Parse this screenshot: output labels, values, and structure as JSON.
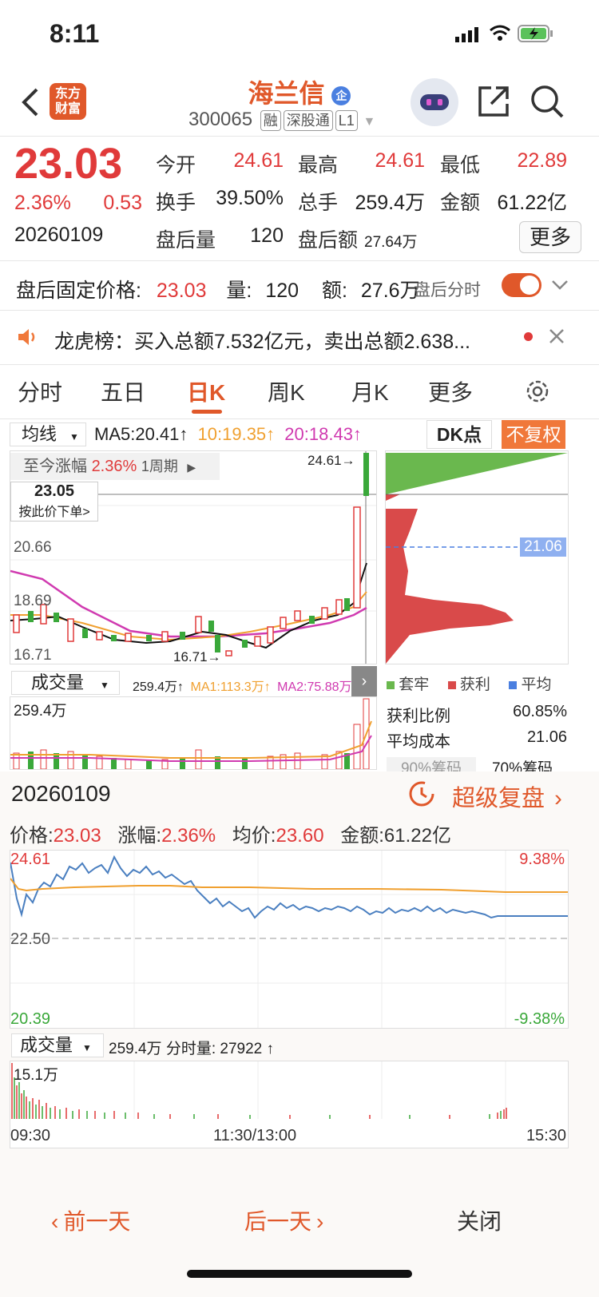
{
  "status": {
    "time": "8:11"
  },
  "header": {
    "title": "海兰信",
    "badge": "企",
    "code": "300065",
    "tags": [
      "融",
      "深股通",
      "L1"
    ],
    "logo_text": [
      "东方",
      "财富"
    ]
  },
  "quote": {
    "price": "23.03",
    "change_pct": "2.36%",
    "change": "0.53",
    "date": "20260109",
    "open_label": "今开",
    "open": "24.61",
    "high_label": "最高",
    "high": "24.61",
    "low_label": "最低",
    "low": "22.89",
    "turnover_label": "换手",
    "turnover": "39.50%",
    "volume_label": "总手",
    "volume": "259.4万",
    "amount_label": "金额",
    "amount": "61.22亿",
    "after_vol_label": "盘后量",
    "after_vol": "120",
    "after_amt_label": "盘后额",
    "after_amt": "27.64万",
    "more": "更多"
  },
  "after_hours": {
    "price_label": "盘后固定价格:",
    "price": "23.03",
    "vol_label": "量:",
    "vol": "120",
    "amt_label": "额:",
    "amt": "27.6万",
    "toggle_label": "盘后分时"
  },
  "news": {
    "text": "龙虎榜：买入总额7.532亿元，卖出总额2.638..."
  },
  "tabs": [
    "分时",
    "五日",
    "日K",
    "周K",
    "月K",
    "更多"
  ],
  "kline": {
    "ma_select": "均线",
    "ma5": "MA5:20.41↑",
    "ma10": "10:19.35↑",
    "ma20": "20:18.43↑",
    "dk": "DK点",
    "fq": "不复权",
    "period_label": "至今涨幅",
    "period_pct": "2.36%",
    "period_n": "1周期",
    "order_price": "23.05",
    "order_text": "按此价下单>",
    "y_labels": [
      "20.66",
      "18.69",
      "16.71"
    ],
    "high_mark": "24.61",
    "low_mark": "16.71",
    "avg_cost_tag": "21.06"
  },
  "volume_panel": {
    "select": "成交量",
    "vol": "259.4万↑",
    "ma1": "MA1:113.3万↑",
    "ma2": "MA2:75.88万",
    "max": "259.4万"
  },
  "chip": {
    "legend": [
      "套牢",
      "获利",
      "平均"
    ],
    "profit_label": "获利比例",
    "profit": "60.85%",
    "avg_label": "平均成本",
    "avg": "21.06",
    "tab90": "90%筹码",
    "tab70": "70%筹码"
  },
  "replay": {
    "date": "20260109",
    "title": "超级复盘",
    "price_label": "价格:",
    "price": "23.03",
    "chg_label": "涨幅:",
    "chg": "2.36%",
    "avg_label": "均价:",
    "avg": "23.60",
    "amt_label": "金额:",
    "amt": "61.22亿",
    "y_top": "24.61",
    "y_mid": "22.50",
    "y_bot": "20.39",
    "pct_top": "9.38%",
    "pct_bot": "-9.38%",
    "vol_select": "成交量",
    "vol_info": "259.4万 分时量: 27922 ↑",
    "vol_max": "15.1万",
    "t_start": "09:30",
    "t_mid": "11:30/13:00",
    "t_end": "15:30"
  },
  "footer": {
    "prev": "前一天",
    "next": "后一天",
    "close": "关闭"
  },
  "colors": {
    "accent": "#e0582a",
    "up": "#e03a3a",
    "down": "#3aa83a"
  }
}
